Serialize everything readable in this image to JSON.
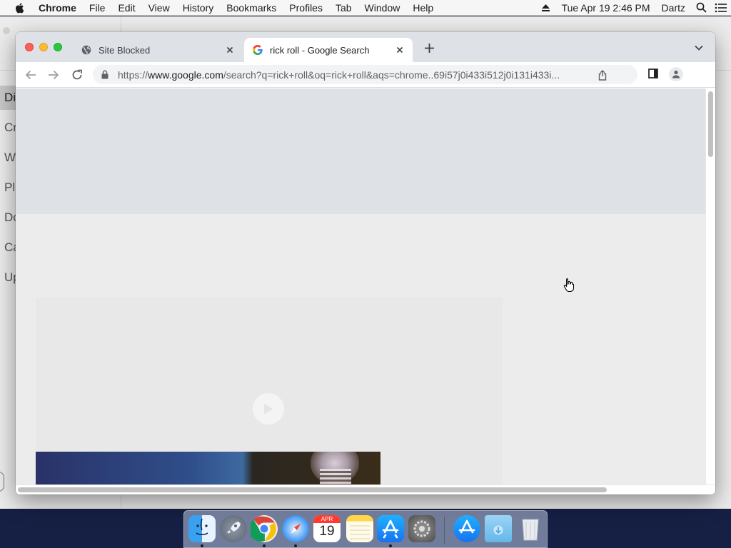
{
  "menubar": {
    "app": "Chrome",
    "items": [
      "File",
      "Edit",
      "View",
      "History",
      "Bookmarks",
      "Profiles",
      "Tab",
      "Window",
      "Help"
    ],
    "datetime": "Tue Apr 19  2:46 PM",
    "user": "Dartz"
  },
  "background_app": {
    "sidebar_items": [
      "Di",
      "Cr",
      "W",
      "Pl",
      "Do",
      "Ca",
      "Up"
    ],
    "footer_letter": "S"
  },
  "browser": {
    "tabs": [
      {
        "title": "Site Blocked",
        "icon": "globe-icon",
        "active": false
      },
      {
        "title": "rick roll - Google Search",
        "icon": "google-icon",
        "active": true
      }
    ],
    "omnibox": {
      "scheme": "https://",
      "host": "www.google.com",
      "path": "/search?q=rick+roll&oq=rick+roll&aqs=chrome..69i57j0i433i512j0i131i433i..."
    }
  },
  "dock": {
    "apps": [
      "Finder",
      "Launchpad",
      "Chrome",
      "Safari",
      "Calendar",
      "Notes",
      "App Store",
      "System Preferences",
      "App Store",
      "Downloads",
      "Trash"
    ],
    "calendar": {
      "month": "APR",
      "day": "19"
    }
  },
  "colors": {
    "accent": "#1a73e8",
    "tab_strip": "#dee1e6",
    "desktop": "#1b2240"
  }
}
